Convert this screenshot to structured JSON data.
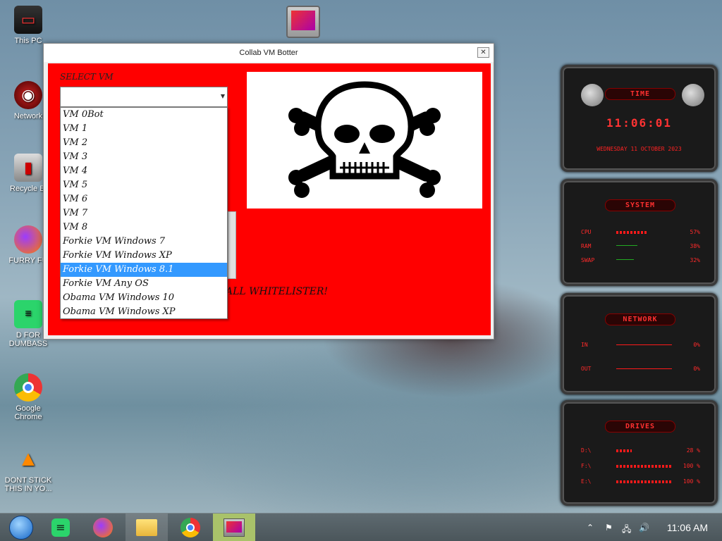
{
  "desktop": {
    "top_icon_name": "Collab VM Botter shortcut",
    "icons": [
      {
        "label": "This PC",
        "icon": "monitor-icon"
      },
      {
        "label": "Network",
        "icon": "network-icon"
      },
      {
        "label": "Recycle Bi",
        "icon": "recycle-bin-icon"
      },
      {
        "label": "FURRY FU",
        "icon": "firefox-icon"
      },
      {
        "label": "D FOR DUMBASS",
        "icon": "green-chat-icon"
      },
      {
        "label": "Google Chrome",
        "icon": "chrome-icon"
      },
      {
        "label": "DONT STICK THIS IN YO...",
        "icon": "vlc-icon"
      }
    ]
  },
  "window": {
    "title": "Collab VM Botter",
    "close_label": "✕",
    "select_label": "SELECT VM",
    "combo_value": "",
    "options": [
      "VM 0Bot",
      "VM 1",
      "VM 2",
      "VM 3",
      "VM 4",
      "VM 5",
      "VM 6",
      "VM 7",
      "VM 8",
      "Forkie VM Windows 7",
      "Forkie VM Windows XP",
      "Forkie VM Windows 8.1",
      "Forkie VM Any OS",
      "Obama VM Windows 10",
      "Obama VM Windows XP"
    ],
    "selected_option": "Forkie VM Windows 8.1",
    "whitelister_text": "ALL WHITELISTER!"
  },
  "widgets": {
    "time": {
      "title": "TIME",
      "clock": "11:06:01",
      "date": "WEDNESDAY 11 OCTOBER 2023"
    },
    "system": {
      "title": "SYSTEM",
      "rows": [
        {
          "label": "CPU",
          "value": "57%",
          "fill": 0.57
        },
        {
          "label": "RAM",
          "value": "38%",
          "fill": 0.38
        },
        {
          "label": "SWAP",
          "value": "32%",
          "fill": 0.32
        }
      ]
    },
    "network": {
      "title": "NETWORK",
      "rows": [
        {
          "label": "IN",
          "value": "0%"
        },
        {
          "label": "OUT",
          "value": "0%"
        }
      ]
    },
    "drives": {
      "title": "DRIVES",
      "rows": [
        {
          "label": "D:\\",
          "value": "28 %",
          "fill": 0.28
        },
        {
          "label": "F:\\",
          "value": "100 %",
          "fill": 1.0
        },
        {
          "label": "E:\\",
          "value": "100 %",
          "fill": 1.0
        }
      ]
    }
  },
  "taskbar": {
    "clock": "11:06 AM",
    "apps": [
      "start-orb-icon",
      "green-chat-icon",
      "firefox-icon",
      "file-explorer-icon",
      "chrome-icon",
      "collab-vm-botter-icon"
    ]
  }
}
